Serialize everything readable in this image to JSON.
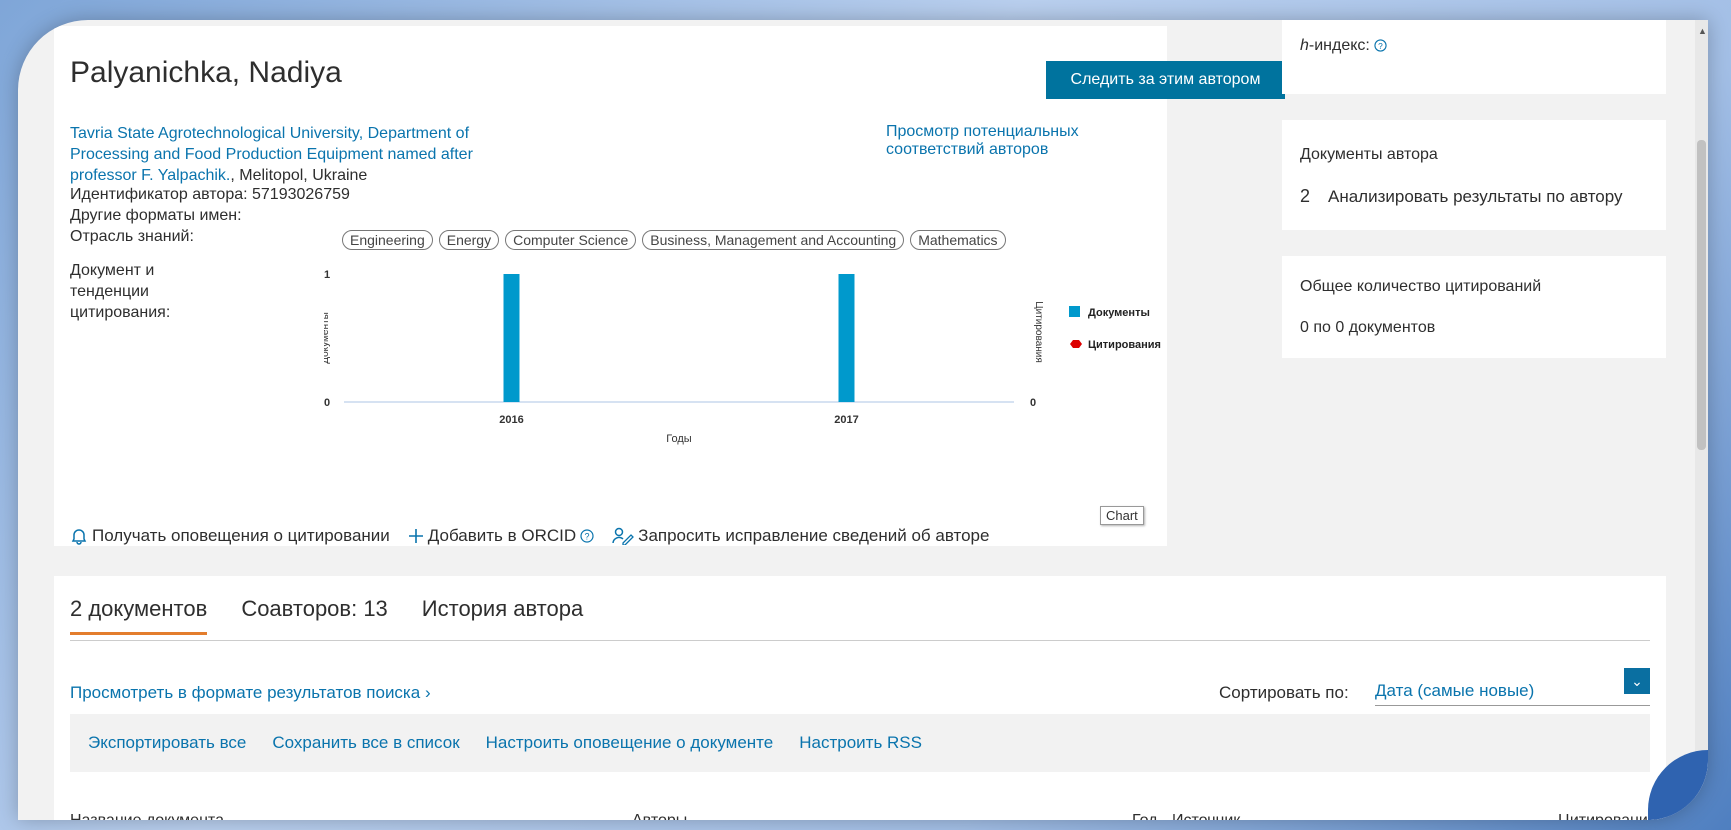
{
  "author": {
    "name": "Palyanichka, Nadiya",
    "follow_button": "Следить за этим автором",
    "potential_matches": "Просмотр потенциальных соответствий авторов",
    "affiliation_link": "Tavria State Agrotechnological University, Department of Processing and Food Production Equipment named after professor F. Yalpachik.",
    "affiliation_city": ", Melitopol, Ukraine",
    "author_id": "Идентификатор автора: 57193026759",
    "other_names": "Другие форматы имен:",
    "subjects_label": "Отрасль знаний:",
    "subjects": [
      "Engineering",
      "Energy",
      "Computer Science",
      "Business, Management and Accounting",
      "Mathematics"
    ],
    "doc_trend_label": "Документ и тенденции цитирования:"
  },
  "chart_data": {
    "type": "bar",
    "categories": [
      "2016",
      "2017"
    ],
    "series": [
      {
        "name": "Документы",
        "values": [
          1,
          1
        ],
        "color": "#0099cc"
      },
      {
        "name": "Цитирования",
        "values": [
          0,
          0
        ],
        "color": "#dd0000"
      }
    ],
    "xlabel": "Годы",
    "ylabel_left": "Документы",
    "ylabel_right": "Цитирования",
    "ylim_left": [
      0,
      1
    ],
    "ylim_right": [
      0,
      0
    ],
    "left_ticks": [
      "1",
      "0"
    ],
    "right_ticks": [
      "0"
    ],
    "legend_position": "right",
    "tooltip": "Chart"
  },
  "actions": {
    "alerts": "Получать оповещения о цитировании",
    "orcid": "Добавить в ORCID",
    "correction": "Запросить исправление сведений об авторе"
  },
  "sidebar": {
    "hindex_label": "-индекс:",
    "hindex_h": "h",
    "docs_label": "Документы автора",
    "docs_count": "2",
    "analyze_link": "Анализировать результаты по автору",
    "citations_label": "Общее количество цитирований",
    "citations_value": "0 по 0 документов"
  },
  "documents": {
    "tabs": [
      "2 документов",
      "Соавторов: 13",
      "История автора"
    ],
    "view_in_search": "Просмотреть в формате результатов поиска",
    "sort_label": "Сортировать по:",
    "sort_value": "Дата (самые новые)",
    "toolbar": [
      "Экспортировать все",
      "Сохранить все в список",
      "Настроить оповещение о документе",
      "Настроить RSS"
    ],
    "columns": {
      "title": "Название документа",
      "authors": "Авторы",
      "year": "Год",
      "source": "Источник",
      "citations": "Цитирования"
    }
  }
}
